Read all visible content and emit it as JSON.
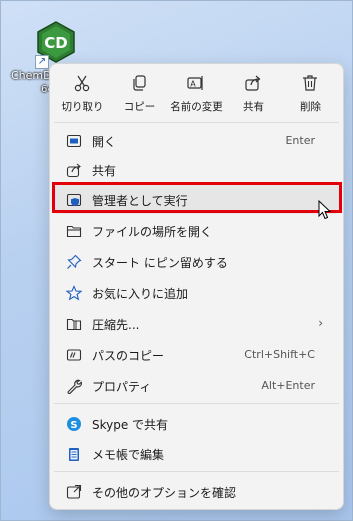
{
  "desktop": {
    "icon_name": "ChemD",
    "icon_subtext": "64",
    "logo_text": "CD",
    "colors": {
      "logo_green": "#2e7d32",
      "logo_dark": "#1b5e20"
    }
  },
  "quick_actions": [
    {
      "label": "切り取り",
      "icon": "scissors-icon"
    },
    {
      "label": "コピー",
      "icon": "copy-icon"
    },
    {
      "label": "名前の変更",
      "icon": "rename-icon"
    },
    {
      "label": "共有",
      "icon": "share-icon"
    },
    {
      "label": "削除",
      "icon": "trash-icon"
    }
  ],
  "items": [
    {
      "label": "開く",
      "accel": "Enter",
      "icon": "open-icon"
    },
    {
      "label": "共有",
      "accel": "",
      "icon": "share-icon"
    },
    {
      "label": "管理者として実行",
      "accel": "",
      "icon": "shield-icon"
    },
    {
      "label": "ファイルの場所を開く",
      "accel": "",
      "icon": "folder-icon"
    },
    {
      "label": "スタート にピン留めする",
      "accel": "",
      "icon": "pin-icon"
    },
    {
      "label": "お気に入りに追加",
      "accel": "",
      "icon": "star-icon"
    },
    {
      "label": "圧縮先...",
      "accel": "",
      "icon": "zip-icon"
    },
    {
      "label": "パスのコピー",
      "accel": "Ctrl+Shift+C",
      "icon": "path-icon"
    },
    {
      "label": "プロパティ",
      "accel": "Alt+Enter",
      "icon": "wrench-icon"
    },
    {
      "label": "Skype で共有",
      "accel": "",
      "icon": "skype-icon"
    },
    {
      "label": "メモ帳で編集",
      "accel": "",
      "icon": "notepad-icon"
    },
    {
      "label": "その他のオプションを確認",
      "accel": "",
      "icon": "more-options-icon"
    }
  ],
  "submenu_chevron": "›",
  "highlight_color": "#e3000b"
}
